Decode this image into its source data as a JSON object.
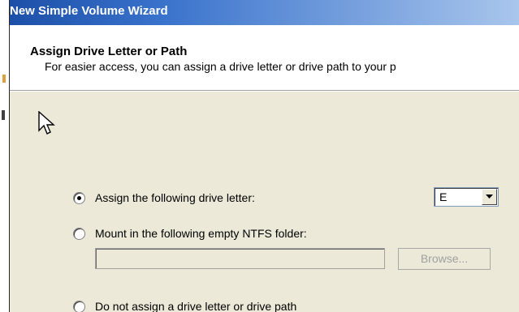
{
  "window": {
    "title": "New Simple Volume Wizard"
  },
  "header": {
    "heading": "Assign Drive Letter or Path",
    "subheading": "For easier access, you can assign a drive letter or drive path to your p"
  },
  "options": {
    "assign_letter": {
      "label": "Assign the following drive letter:",
      "checked": true
    },
    "mount_folder": {
      "label": "Mount in the following empty NTFS folder:",
      "checked": false
    },
    "no_assign": {
      "label": "Do not assign a drive letter or drive path",
      "checked": false
    }
  },
  "drive_letter": {
    "selected": "E"
  },
  "folder": {
    "value": "",
    "browse_label": "Browse..."
  },
  "colors": {
    "title_bar_start": "#1c4fa8",
    "title_bar_end": "#a9c6ec",
    "dialog_background": "#ece9d8",
    "disabled_text": "#a0a0a0"
  },
  "icons": {
    "cursor": "arrow-cursor-icon",
    "dropdown": "chevron-down-icon"
  }
}
